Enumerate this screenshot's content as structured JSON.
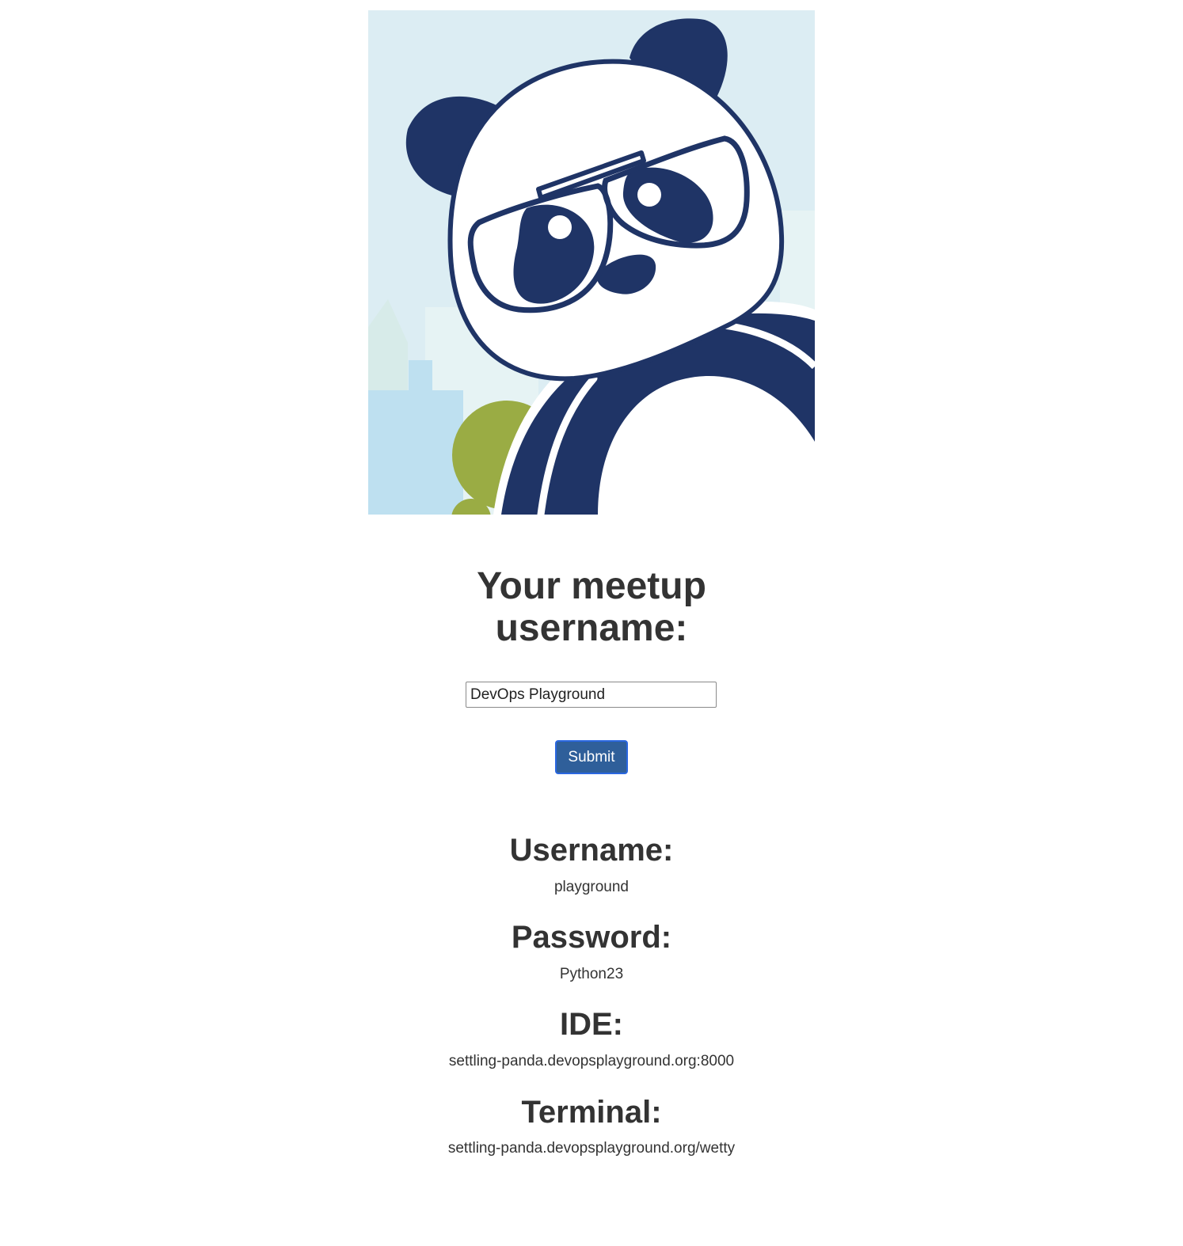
{
  "hero": {
    "image": "panda-mascot-illustration",
    "colors": {
      "sky": "#dcedf3",
      "panda_dark": "#1f3466",
      "building_blue": "#bee0f0",
      "building_pale": "#e6f3f4",
      "tree_green": "#9aac44"
    }
  },
  "form": {
    "title_line1": "Your meetup",
    "title_line2": "username:",
    "username_value": "DevOps Playground",
    "submit_label": "Submit",
    "accent": "#2f5f9a"
  },
  "credentials": {
    "username_heading": "Username:",
    "username_value": "playground",
    "password_heading": "Password:",
    "password_value": "Python23",
    "ide_heading": "IDE:",
    "ide_value": "settling-panda.devopsplayground.org:8000",
    "terminal_heading": "Terminal:",
    "terminal_value": "settling-panda.devopsplayground.org/wetty"
  }
}
